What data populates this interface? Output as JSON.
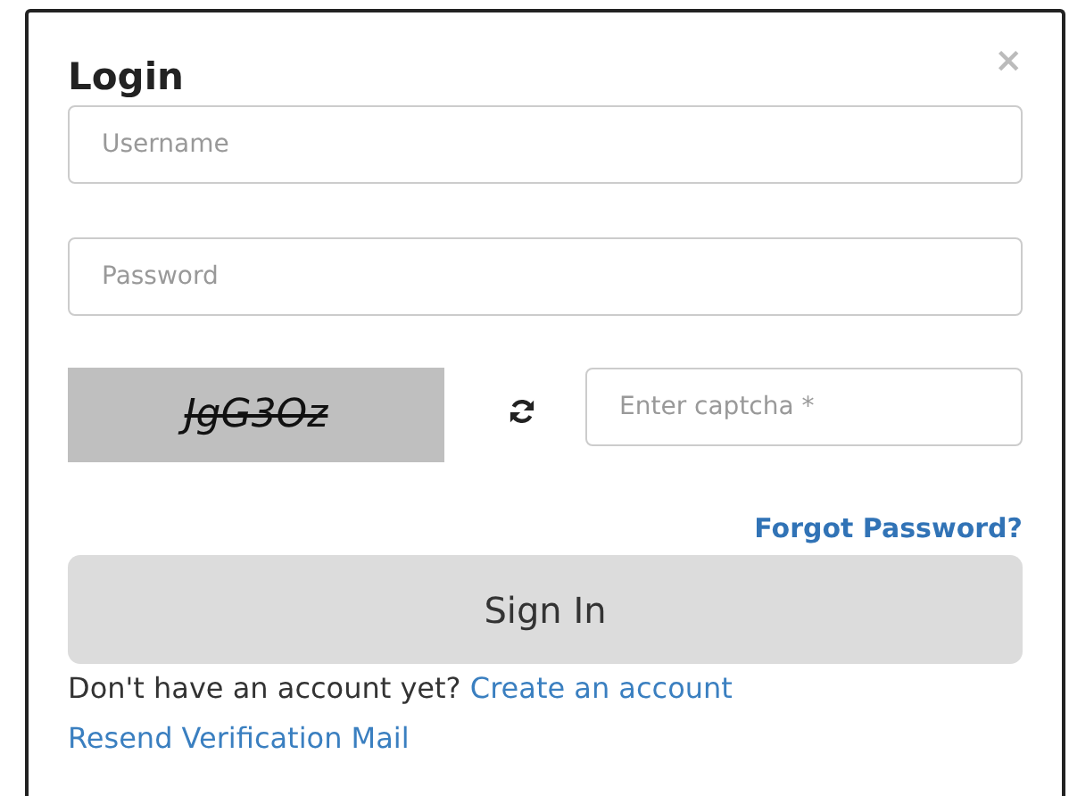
{
  "dialog": {
    "title": "Login",
    "close": "×"
  },
  "username": {
    "placeholder": "Username"
  },
  "password": {
    "placeholder": "Password"
  },
  "captcha": {
    "code": "JgG3Oz",
    "placeholder": "Enter captcha *"
  },
  "forgot_link": "Forgot Password?",
  "sign_in_button": "Sign In",
  "signup_prompt": "Don't have an account yet?",
  "signup_link": "Create an account",
  "resend_link": "Resend Verification Mail"
}
